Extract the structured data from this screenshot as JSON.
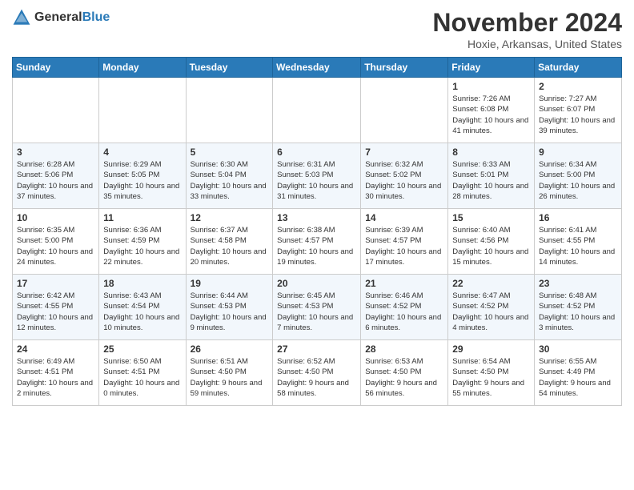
{
  "header": {
    "logo_general": "General",
    "logo_blue": "Blue",
    "month_title": "November 2024",
    "location": "Hoxie, Arkansas, United States"
  },
  "weekdays": [
    "Sunday",
    "Monday",
    "Tuesday",
    "Wednesday",
    "Thursday",
    "Friday",
    "Saturday"
  ],
  "weeks": [
    [
      {
        "day": "",
        "info": ""
      },
      {
        "day": "",
        "info": ""
      },
      {
        "day": "",
        "info": ""
      },
      {
        "day": "",
        "info": ""
      },
      {
        "day": "",
        "info": ""
      },
      {
        "day": "1",
        "info": "Sunrise: 7:26 AM\nSunset: 6:08 PM\nDaylight: 10 hours and 41 minutes."
      },
      {
        "day": "2",
        "info": "Sunrise: 7:27 AM\nSunset: 6:07 PM\nDaylight: 10 hours and 39 minutes."
      }
    ],
    [
      {
        "day": "3",
        "info": "Sunrise: 6:28 AM\nSunset: 5:06 PM\nDaylight: 10 hours and 37 minutes."
      },
      {
        "day": "4",
        "info": "Sunrise: 6:29 AM\nSunset: 5:05 PM\nDaylight: 10 hours and 35 minutes."
      },
      {
        "day": "5",
        "info": "Sunrise: 6:30 AM\nSunset: 5:04 PM\nDaylight: 10 hours and 33 minutes."
      },
      {
        "day": "6",
        "info": "Sunrise: 6:31 AM\nSunset: 5:03 PM\nDaylight: 10 hours and 31 minutes."
      },
      {
        "day": "7",
        "info": "Sunrise: 6:32 AM\nSunset: 5:02 PM\nDaylight: 10 hours and 30 minutes."
      },
      {
        "day": "8",
        "info": "Sunrise: 6:33 AM\nSunset: 5:01 PM\nDaylight: 10 hours and 28 minutes."
      },
      {
        "day": "9",
        "info": "Sunrise: 6:34 AM\nSunset: 5:00 PM\nDaylight: 10 hours and 26 minutes."
      }
    ],
    [
      {
        "day": "10",
        "info": "Sunrise: 6:35 AM\nSunset: 5:00 PM\nDaylight: 10 hours and 24 minutes."
      },
      {
        "day": "11",
        "info": "Sunrise: 6:36 AM\nSunset: 4:59 PM\nDaylight: 10 hours and 22 minutes."
      },
      {
        "day": "12",
        "info": "Sunrise: 6:37 AM\nSunset: 4:58 PM\nDaylight: 10 hours and 20 minutes."
      },
      {
        "day": "13",
        "info": "Sunrise: 6:38 AM\nSunset: 4:57 PM\nDaylight: 10 hours and 19 minutes."
      },
      {
        "day": "14",
        "info": "Sunrise: 6:39 AM\nSunset: 4:57 PM\nDaylight: 10 hours and 17 minutes."
      },
      {
        "day": "15",
        "info": "Sunrise: 6:40 AM\nSunset: 4:56 PM\nDaylight: 10 hours and 15 minutes."
      },
      {
        "day": "16",
        "info": "Sunrise: 6:41 AM\nSunset: 4:55 PM\nDaylight: 10 hours and 14 minutes."
      }
    ],
    [
      {
        "day": "17",
        "info": "Sunrise: 6:42 AM\nSunset: 4:55 PM\nDaylight: 10 hours and 12 minutes."
      },
      {
        "day": "18",
        "info": "Sunrise: 6:43 AM\nSunset: 4:54 PM\nDaylight: 10 hours and 10 minutes."
      },
      {
        "day": "19",
        "info": "Sunrise: 6:44 AM\nSunset: 4:53 PM\nDaylight: 10 hours and 9 minutes."
      },
      {
        "day": "20",
        "info": "Sunrise: 6:45 AM\nSunset: 4:53 PM\nDaylight: 10 hours and 7 minutes."
      },
      {
        "day": "21",
        "info": "Sunrise: 6:46 AM\nSunset: 4:52 PM\nDaylight: 10 hours and 6 minutes."
      },
      {
        "day": "22",
        "info": "Sunrise: 6:47 AM\nSunset: 4:52 PM\nDaylight: 10 hours and 4 minutes."
      },
      {
        "day": "23",
        "info": "Sunrise: 6:48 AM\nSunset: 4:52 PM\nDaylight: 10 hours and 3 minutes."
      }
    ],
    [
      {
        "day": "24",
        "info": "Sunrise: 6:49 AM\nSunset: 4:51 PM\nDaylight: 10 hours and 2 minutes."
      },
      {
        "day": "25",
        "info": "Sunrise: 6:50 AM\nSunset: 4:51 PM\nDaylight: 10 hours and 0 minutes."
      },
      {
        "day": "26",
        "info": "Sunrise: 6:51 AM\nSunset: 4:50 PM\nDaylight: 9 hours and 59 minutes."
      },
      {
        "day": "27",
        "info": "Sunrise: 6:52 AM\nSunset: 4:50 PM\nDaylight: 9 hours and 58 minutes."
      },
      {
        "day": "28",
        "info": "Sunrise: 6:53 AM\nSunset: 4:50 PM\nDaylight: 9 hours and 56 minutes."
      },
      {
        "day": "29",
        "info": "Sunrise: 6:54 AM\nSunset: 4:50 PM\nDaylight: 9 hours and 55 minutes."
      },
      {
        "day": "30",
        "info": "Sunrise: 6:55 AM\nSunset: 4:49 PM\nDaylight: 9 hours and 54 minutes."
      }
    ]
  ]
}
